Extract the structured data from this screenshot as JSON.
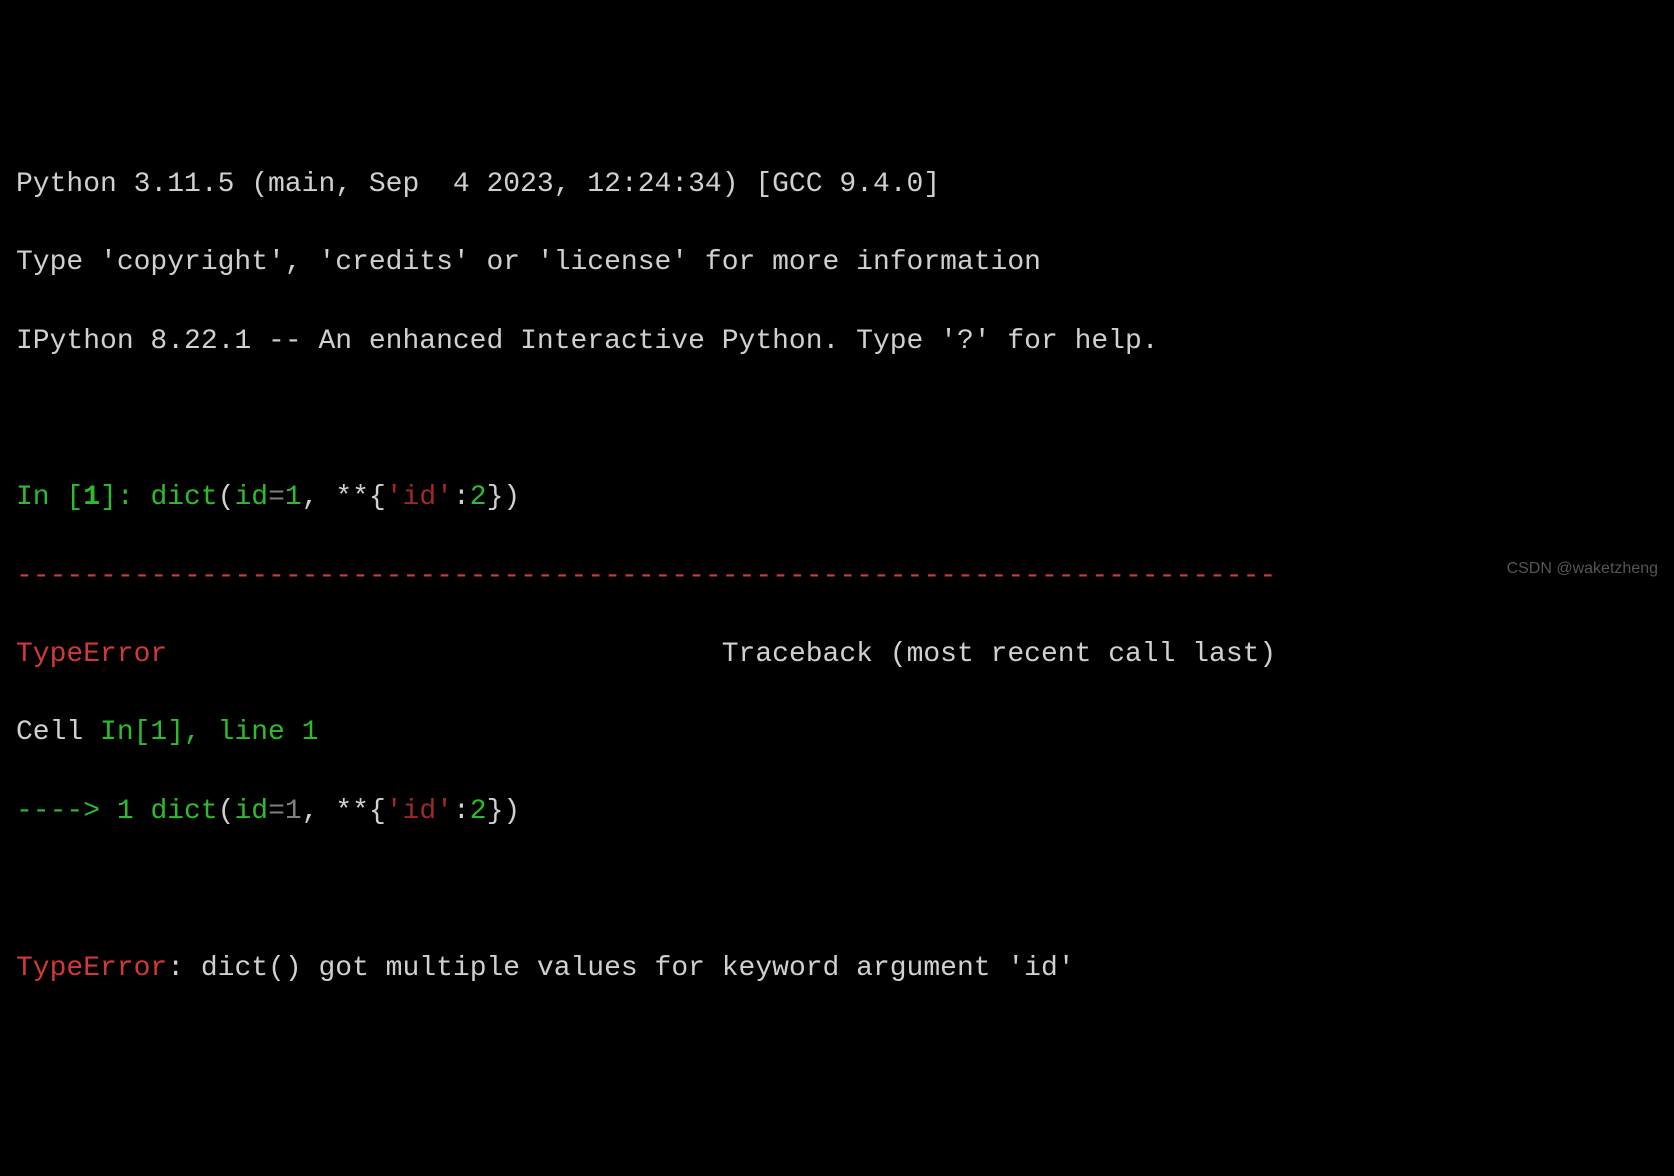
{
  "header": {
    "python_version": "Python 3.11.5 (main, Sep  4 2023, 12:24:34) [GCC 9.4.0]",
    "copyright_line": "Type 'copyright', 'credits' or 'license' for more information",
    "ipython_version": "IPython 8.22.1 -- An enhanced Interactive Python. Type '?' for help."
  },
  "prompt": {
    "in_label": "In [",
    "in_num": "1",
    "in_close": "]: ",
    "call_func": "dict",
    "paren_open": "(",
    "kw_id": "id",
    "eq1": "=",
    "val1": "1",
    "comma_sp": ", ",
    "stars": "**",
    "brace_open": "{",
    "str_id": "'id'",
    "colon": ":",
    "val2": "2",
    "brace_close": "}",
    "paren_close": ")"
  },
  "separator": "---------------------------------------------------------------------------",
  "error": {
    "type": "TypeError",
    "traceback_label": "Traceback (most recent call last)",
    "cell_prefix": "Cell ",
    "cell_ref": "In[1]",
    "line_ref": ", line 1",
    "arrow": "----> ",
    "arrow_num": "1",
    "space": " ",
    "message_prefix": "TypeError",
    "message_sep": ": ",
    "message": "dict() got multiple values for keyword argument 'id'"
  },
  "watermark": "CSDN @waketzheng"
}
